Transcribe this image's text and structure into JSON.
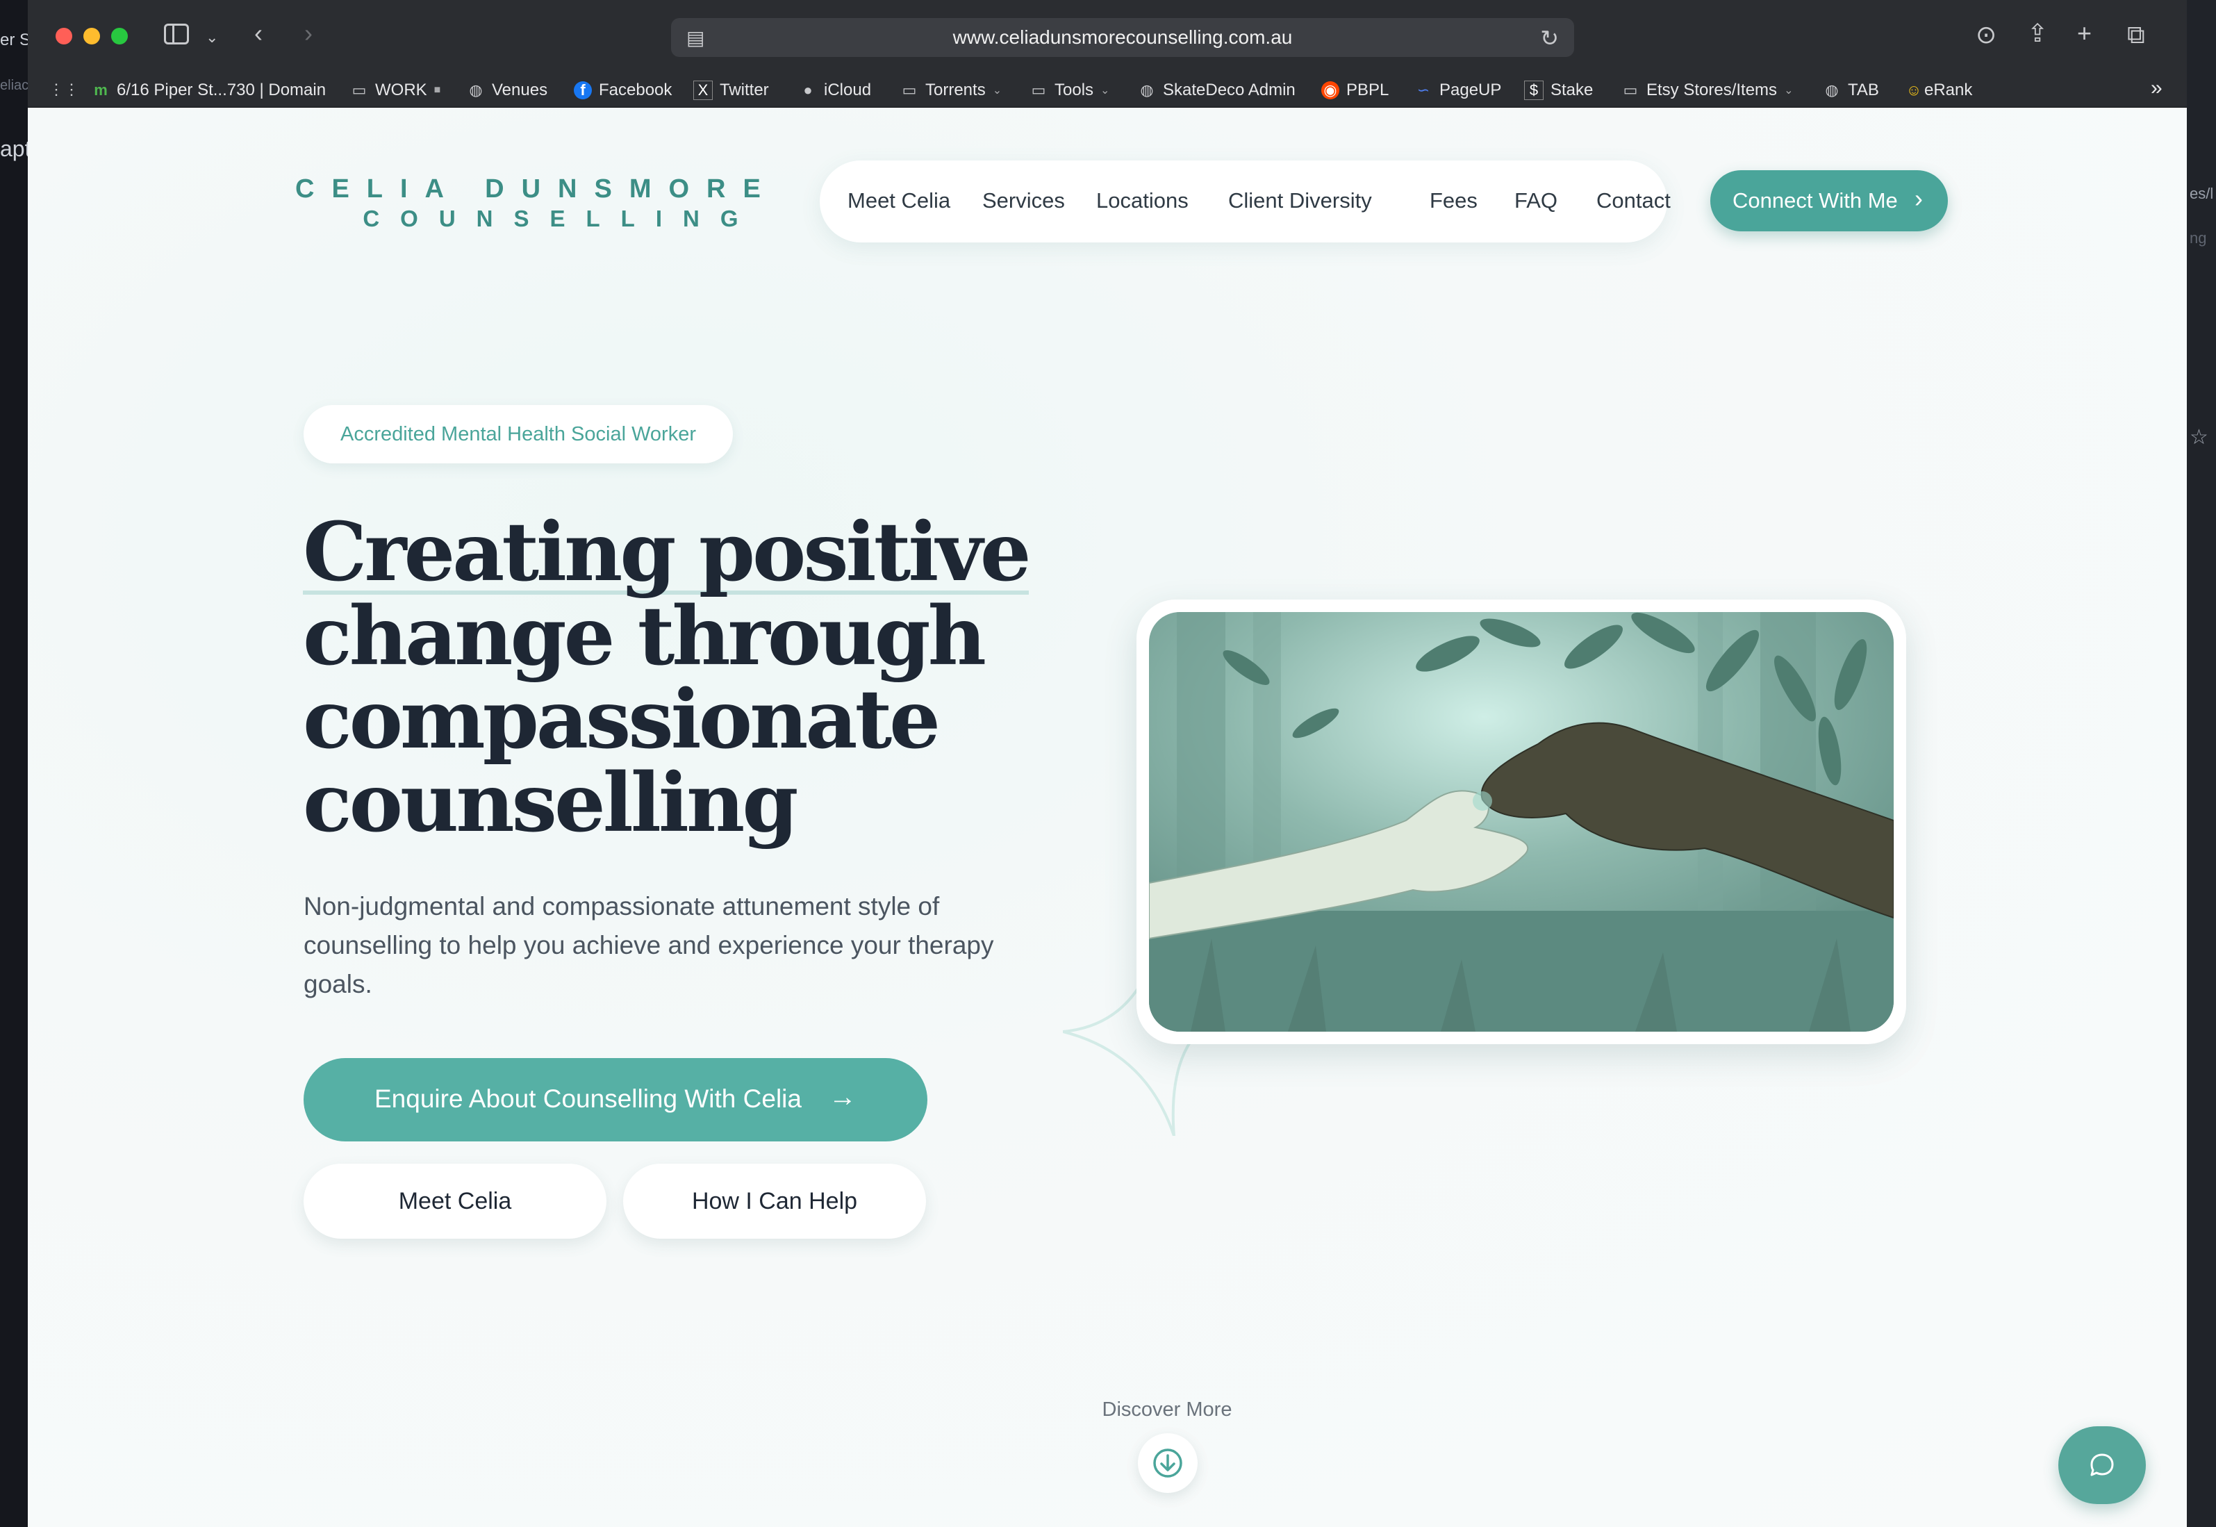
{
  "desktop": {
    "left_fragments": [
      "er S",
      "eliac",
      "apt"
    ],
    "right_fragments": [
      "es/l",
      "ng"
    ]
  },
  "browser": {
    "url": "www.celiadunsmorecounselling.com.au",
    "bookmarks": [
      {
        "label": "6/16 Piper St...730 | Domain",
        "icon": "domain-m-icon"
      },
      {
        "label": "WORK",
        "icon": "folder-icon"
      },
      {
        "label": "Venues",
        "icon": "globe-icon"
      },
      {
        "label": "Facebook",
        "icon": "facebook-icon"
      },
      {
        "label": "Twitter",
        "icon": "x-icon"
      },
      {
        "label": "iCloud",
        "icon": "apple-icon"
      },
      {
        "label": "Torrents",
        "icon": "folder-icon"
      },
      {
        "label": "Tools",
        "icon": "folder-icon"
      },
      {
        "label": "SkateDeco Admin",
        "icon": "globe-icon"
      },
      {
        "label": "PBPL",
        "icon": "reddit-icon"
      },
      {
        "label": "PageUP",
        "icon": "pageup-icon"
      },
      {
        "label": "Stake",
        "icon": "stake-icon"
      },
      {
        "label": "Etsy Stores/Items",
        "icon": "folder-icon"
      },
      {
        "label": "TAB",
        "icon": "globe-icon"
      },
      {
        "label": "eRank",
        "icon": "smiley-icon"
      }
    ]
  },
  "site": {
    "logo_line1": "CELIA DUNSMORE",
    "logo_line2": "COUNSELLING",
    "nav": [
      "Meet Celia",
      "Services",
      "Locations",
      "Client Diversity",
      "Fees",
      "FAQ",
      "Contact"
    ],
    "connect_label": "Connect With Me",
    "badge": "Accredited Mental Health Social Worker",
    "headline": [
      "Creating positive",
      "change through",
      "compassionate",
      "counselling"
    ],
    "subtext": "Non-judgmental and compassionate attunement style of counselling to help you achieve and experience your therapy goals.",
    "enquire_label": "Enquire About Counselling With Celia",
    "meet_label": "Meet Celia",
    "help_label": "How I Can Help",
    "discover_label": "Discover More"
  },
  "colors": {
    "brand_teal": "#4aa59a",
    "headline": "#1e2734",
    "body_text": "#4b5560"
  }
}
